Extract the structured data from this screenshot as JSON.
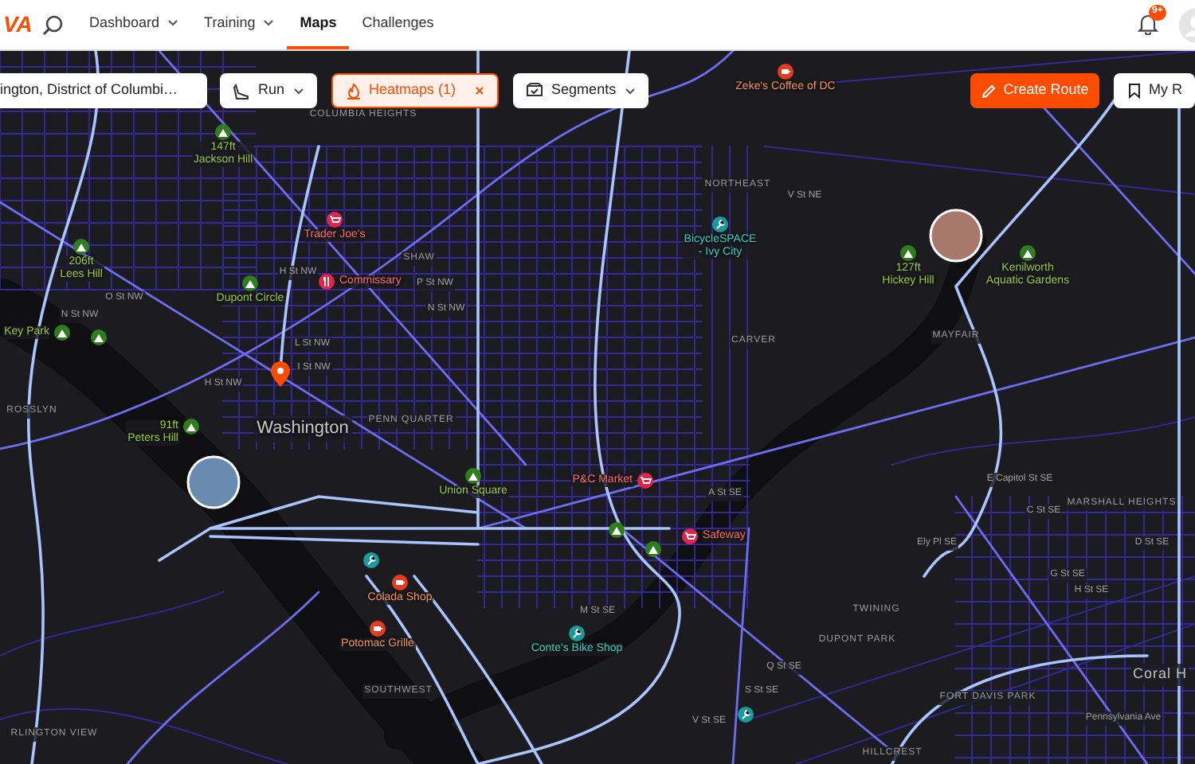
{
  "nav": {
    "logo": "VA",
    "items": [
      {
        "label": "Dashboard",
        "dropdown": true,
        "selected": false
      },
      {
        "label": "Training",
        "dropdown": true,
        "selected": false
      },
      {
        "label": "Maps",
        "dropdown": false,
        "selected": true
      },
      {
        "label": "Challenges",
        "dropdown": false,
        "selected": false
      }
    ],
    "notification_badge": "9+"
  },
  "toolbar": {
    "location": {
      "value": "ington, District of Columbi…"
    },
    "filters": [
      {
        "kind": "sport",
        "label": "Run",
        "active": false
      },
      {
        "kind": "heatmap",
        "label": "Heatmaps (1)",
        "active": true
      },
      {
        "kind": "segments",
        "label": "Segments",
        "active": false
      }
    ],
    "actions": [
      {
        "kind": "primary",
        "label": "Create Route"
      },
      {
        "kind": "secondary",
        "label": "My R"
      }
    ]
  },
  "map": {
    "city": "Washington",
    "pois": [
      {
        "kind": "peak",
        "lines": [
          "147ft",
          "Jackson Hill"
        ]
      },
      {
        "kind": "peak",
        "lines": [
          "206ft",
          "Lees Hill"
        ]
      },
      {
        "kind": "peak",
        "lines": [
          "Dupont Circle"
        ]
      },
      {
        "kind": "peak",
        "lines": [
          "Key Park"
        ]
      },
      {
        "kind": "peak"
      },
      {
        "kind": "peak",
        "lines": [
          "91ft",
          "Peters Hill"
        ]
      },
      {
        "kind": "shop",
        "lines": [
          "Trader Joe's"
        ]
      },
      {
        "kind": "food",
        "lines": [
          "Commissary"
        ]
      },
      {
        "kind": "coffee",
        "lines": [
          "Zeke's Coffee of DC"
        ]
      },
      {
        "kind": "bike",
        "lines": [
          "BicycleSPACE",
          "- Ivy City"
        ]
      },
      {
        "kind": "peak",
        "lines": [
          "127ft",
          "Hickey Hill"
        ]
      },
      {
        "kind": "peak",
        "lines": [
          "Kenilworth",
          "Aquatic Gardens"
        ]
      },
      {
        "kind": "peak",
        "lines": [
          "Union Square"
        ]
      },
      {
        "kind": "shop",
        "lines": [
          "P&C Market"
        ]
      },
      {
        "kind": "shop",
        "lines": [
          "Safeway"
        ]
      },
      {
        "kind": "peak"
      },
      {
        "kind": "peak"
      },
      {
        "kind": "bike"
      },
      {
        "kind": "coffee",
        "lines": [
          "Colada Shop"
        ]
      },
      {
        "kind": "coffee",
        "lines": [
          "Potomac Grille"
        ]
      },
      {
        "kind": "bike",
        "lines": [
          "Conte's Bike Shop"
        ]
      },
      {
        "kind": "bike"
      }
    ],
    "areas": [
      {
        "label": "COLUMBIA HEIGHTS"
      },
      {
        "label": "SHAW"
      },
      {
        "label": "ROSSLYN"
      },
      {
        "label": "PENN QUARTER"
      },
      {
        "label": "NORTHEAST"
      },
      {
        "label": "CARVER"
      },
      {
        "label": "MAYFAIR"
      },
      {
        "label": "SOUTHWEST"
      },
      {
        "label": "TWINING"
      },
      {
        "label": "DUPONT PARK"
      },
      {
        "label": "FORT DAVIS PARK"
      },
      {
        "label": "MARSHALL HEIGHTS"
      },
      {
        "label": "Coral H"
      },
      {
        "label": "RLINGTON VIEW"
      },
      {
        "label": "HILLCREST"
      }
    ],
    "streets": [
      {
        "label": "H St NW"
      },
      {
        "label": "P St NW"
      },
      {
        "label": "N St NW"
      },
      {
        "label": "O St NW"
      },
      {
        "label": "N St NW"
      },
      {
        "label": "L St NW"
      },
      {
        "label": "I St NW"
      },
      {
        "label": "H St NW"
      },
      {
        "label": "V St NE"
      },
      {
        "label": "A St SE"
      },
      {
        "label": "E Capitol St SE"
      },
      {
        "label": "C St SE"
      },
      {
        "label": "Ely Pl SE"
      },
      {
        "label": "D St SE"
      },
      {
        "label": "G St SE"
      },
      {
        "label": "H St SE"
      },
      {
        "label": "M St SE"
      },
      {
        "label": "Q St SE"
      },
      {
        "label": "S St SE"
      },
      {
        "label": "V St SE"
      },
      {
        "label": "Pennsylvania Ave"
      }
    ]
  }
}
